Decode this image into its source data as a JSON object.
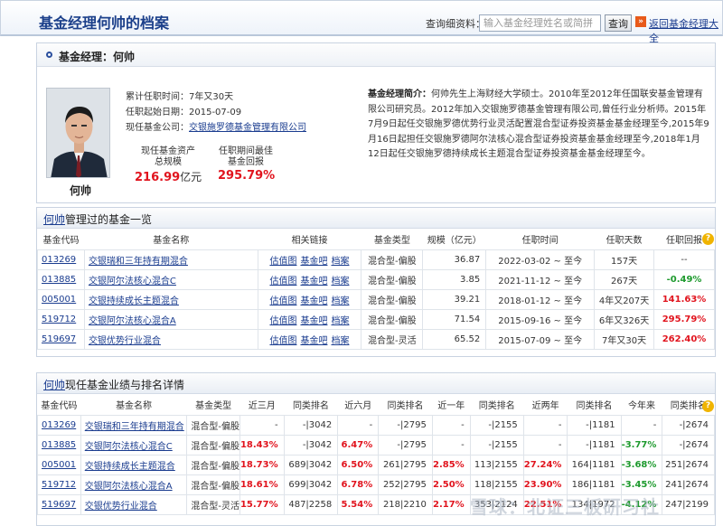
{
  "header": {
    "title": "基金经理何帅的档案",
    "search_label": "查询细资料：",
    "search_placeholder": "输入基金经理姓名或简拼",
    "search_button": "查询",
    "back_icon": "»",
    "back_link": "返回基金经理大全"
  },
  "manager": {
    "section_title": "基金经理：何帅",
    "name": "何帅",
    "tenure_label": "累计任职时间：",
    "tenure_value": "7年又30天",
    "start_label": "任职起始日期：",
    "start_value": "2015-07-09",
    "company_label": "现任基金公司：",
    "company_value": "交银施罗德基金管理有限公司",
    "aum_label_1": "现任基金资产",
    "aum_label_2": "总规模",
    "aum_value": "216.99",
    "aum_unit": "亿元",
    "best_label_1": "任职期间最佳",
    "best_label_2": "基金回报",
    "best_value": "295.79%",
    "bio_label": "基金经理简介：",
    "bio_text": "何帅先生上海财经大学硕士。2010年至2012年任国联安基金管理有限公司研究员。2012年加入交银施罗德基金管理有限公司,曾任行业分析师。2015年7月9日起任交银施罗德优势行业灵活配置混合型证券投资基金基金经理至今,2015年9月16日起担任交银施罗德阿尔法核心混合型证券投资基金基金经理至今,2018年1月12日起任交银施罗德持续成长主题混合型证券投资基金基金经理至今。"
  },
  "managed": {
    "title_link": "何帅",
    "title_rest": "管理过的基金一览",
    "headers": [
      "基金代码",
      "基金名称",
      "相关链接",
      "基金类型",
      "规模（亿元）",
      "任职时间",
      "任职天数",
      "任职回报"
    ],
    "link_labels": [
      "估值图",
      "基金吧",
      "档案"
    ],
    "rows": [
      {
        "code": "013269",
        "name": "交银瑞和三年持有期混合",
        "type": "混合型-偏股",
        "size": "36.87",
        "period": "2022-03-02 ~ 至今",
        "days": "157天",
        "ret": "--",
        "cls": ""
      },
      {
        "code": "013885",
        "name": "交银阿尔法核心混合C",
        "type": "混合型-偏股",
        "size": "3.85",
        "period": "2021-11-12 ~ 至今",
        "days": "267天",
        "ret": "-0.49%",
        "cls": "green"
      },
      {
        "code": "005001",
        "name": "交银持续成长主题混合",
        "type": "混合型-偏股",
        "size": "39.21",
        "period": "2018-01-12 ~ 至今",
        "days": "4年又207天",
        "ret": "141.63%",
        "cls": "red"
      },
      {
        "code": "519712",
        "name": "交银阿尔法核心混合A",
        "type": "混合型-偏股",
        "size": "71.54",
        "period": "2015-09-16 ~ 至今",
        "days": "6年又326天",
        "ret": "295.79%",
        "cls": "red"
      },
      {
        "code": "519697",
        "name": "交银优势行业混合",
        "type": "混合型-灵活",
        "size": "65.52",
        "period": "2015-07-09 ~ 至今",
        "days": "7年又30天",
        "ret": "262.40%",
        "cls": "red"
      }
    ]
  },
  "current": {
    "title_link": "何帅",
    "title_rest": "现任基金业绩与排名详情",
    "headers": [
      "基金代码",
      "基金名称",
      "基金类型",
      "近三月",
      "同类排名",
      "近六月",
      "同类排名",
      "近一年",
      "同类排名",
      "近两年",
      "同类排名",
      "今年来",
      "同类排名"
    ],
    "rows": [
      {
        "code": "013269",
        "name": "交银瑞和三年持有期混合",
        "type": "混合型-偏股",
        "c": [
          [
            "-",
            ""
          ],
          [
            "-|3042",
            ""
          ],
          [
            "-",
            ""
          ],
          [
            "-|2795",
            ""
          ],
          [
            "-",
            ""
          ],
          [
            "-|2155",
            ""
          ],
          [
            "-",
            ""
          ],
          [
            "-|1181",
            ""
          ],
          [
            "-",
            ""
          ],
          [
            "-|2674",
            ""
          ]
        ]
      },
      {
        "code": "013885",
        "name": "交银阿尔法核心混合C",
        "type": "混合型-偏股",
        "c": [
          [
            "18.43%",
            "red"
          ],
          [
            "-|3042",
            ""
          ],
          [
            "6.47%",
            "red"
          ],
          [
            "-|2795",
            ""
          ],
          [
            "-",
            ""
          ],
          [
            "-|2155",
            ""
          ],
          [
            "-",
            ""
          ],
          [
            "-|1181",
            ""
          ],
          [
            "-3.77%",
            "green"
          ],
          [
            "-|2674",
            ""
          ]
        ]
      },
      {
        "code": "005001",
        "name": "交银持续成长主题混合",
        "type": "混合型-偏股",
        "c": [
          [
            "18.73%",
            "red"
          ],
          [
            "689|3042",
            ""
          ],
          [
            "6.50%",
            "red"
          ],
          [
            "261|2795",
            ""
          ],
          [
            "2.85%",
            "red"
          ],
          [
            "113|2155",
            ""
          ],
          [
            "27.24%",
            "red"
          ],
          [
            "164|1181",
            ""
          ],
          [
            "-3.68%",
            "green"
          ],
          [
            "251|2674",
            ""
          ]
        ]
      },
      {
        "code": "519712",
        "name": "交银阿尔法核心混合A",
        "type": "混合型-偏股",
        "c": [
          [
            "18.61%",
            "red"
          ],
          [
            "699|3042",
            ""
          ],
          [
            "6.78%",
            "red"
          ],
          [
            "252|2795",
            ""
          ],
          [
            "2.50%",
            "red"
          ],
          [
            "118|2155",
            ""
          ],
          [
            "23.90%",
            "red"
          ],
          [
            "186|1181",
            ""
          ],
          [
            "-3.45%",
            "green"
          ],
          [
            "241|2674",
            ""
          ]
        ]
      },
      {
        "code": "519697",
        "name": "交银优势行业混合",
        "type": "混合型-灵活",
        "c": [
          [
            "15.77%",
            "red"
          ],
          [
            "487|2258",
            ""
          ],
          [
            "5.54%",
            "red"
          ],
          [
            "218|2210",
            ""
          ],
          [
            "2.17%",
            "red"
          ],
          [
            "353|2124",
            ""
          ],
          [
            "22.51%",
            "red"
          ],
          [
            "134|1972",
            ""
          ],
          [
            "-4.12%",
            "green"
          ],
          [
            "247|2199",
            ""
          ]
        ]
      }
    ]
  },
  "watermark": "雪球：北证三板研习社"
}
